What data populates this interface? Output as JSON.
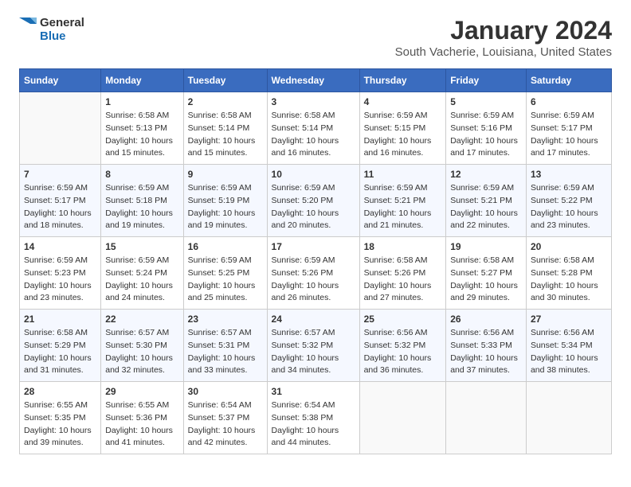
{
  "logo": {
    "line1": "General",
    "line2": "Blue"
  },
  "title": "January 2024",
  "subtitle": "South Vacherie, Louisiana, United States",
  "days_of_week": [
    "Sunday",
    "Monday",
    "Tuesday",
    "Wednesday",
    "Thursday",
    "Friday",
    "Saturday"
  ],
  "weeks": [
    [
      {
        "day": "",
        "sunrise": "",
        "sunset": "",
        "daylight": ""
      },
      {
        "day": "1",
        "sunrise": "Sunrise: 6:58 AM",
        "sunset": "Sunset: 5:13 PM",
        "daylight": "Daylight: 10 hours and 15 minutes."
      },
      {
        "day": "2",
        "sunrise": "Sunrise: 6:58 AM",
        "sunset": "Sunset: 5:14 PM",
        "daylight": "Daylight: 10 hours and 15 minutes."
      },
      {
        "day": "3",
        "sunrise": "Sunrise: 6:58 AM",
        "sunset": "Sunset: 5:14 PM",
        "daylight": "Daylight: 10 hours and 16 minutes."
      },
      {
        "day": "4",
        "sunrise": "Sunrise: 6:59 AM",
        "sunset": "Sunset: 5:15 PM",
        "daylight": "Daylight: 10 hours and 16 minutes."
      },
      {
        "day": "5",
        "sunrise": "Sunrise: 6:59 AM",
        "sunset": "Sunset: 5:16 PM",
        "daylight": "Daylight: 10 hours and 17 minutes."
      },
      {
        "day": "6",
        "sunrise": "Sunrise: 6:59 AM",
        "sunset": "Sunset: 5:17 PM",
        "daylight": "Daylight: 10 hours and 17 minutes."
      }
    ],
    [
      {
        "day": "7",
        "sunrise": "Sunrise: 6:59 AM",
        "sunset": "Sunset: 5:17 PM",
        "daylight": "Daylight: 10 hours and 18 minutes."
      },
      {
        "day": "8",
        "sunrise": "Sunrise: 6:59 AM",
        "sunset": "Sunset: 5:18 PM",
        "daylight": "Daylight: 10 hours and 19 minutes."
      },
      {
        "day": "9",
        "sunrise": "Sunrise: 6:59 AM",
        "sunset": "Sunset: 5:19 PM",
        "daylight": "Daylight: 10 hours and 19 minutes."
      },
      {
        "day": "10",
        "sunrise": "Sunrise: 6:59 AM",
        "sunset": "Sunset: 5:20 PM",
        "daylight": "Daylight: 10 hours and 20 minutes."
      },
      {
        "day": "11",
        "sunrise": "Sunrise: 6:59 AM",
        "sunset": "Sunset: 5:21 PM",
        "daylight": "Daylight: 10 hours and 21 minutes."
      },
      {
        "day": "12",
        "sunrise": "Sunrise: 6:59 AM",
        "sunset": "Sunset: 5:21 PM",
        "daylight": "Daylight: 10 hours and 22 minutes."
      },
      {
        "day": "13",
        "sunrise": "Sunrise: 6:59 AM",
        "sunset": "Sunset: 5:22 PM",
        "daylight": "Daylight: 10 hours and 23 minutes."
      }
    ],
    [
      {
        "day": "14",
        "sunrise": "Sunrise: 6:59 AM",
        "sunset": "Sunset: 5:23 PM",
        "daylight": "Daylight: 10 hours and 23 minutes."
      },
      {
        "day": "15",
        "sunrise": "Sunrise: 6:59 AM",
        "sunset": "Sunset: 5:24 PM",
        "daylight": "Daylight: 10 hours and 24 minutes."
      },
      {
        "day": "16",
        "sunrise": "Sunrise: 6:59 AM",
        "sunset": "Sunset: 5:25 PM",
        "daylight": "Daylight: 10 hours and 25 minutes."
      },
      {
        "day": "17",
        "sunrise": "Sunrise: 6:59 AM",
        "sunset": "Sunset: 5:26 PM",
        "daylight": "Daylight: 10 hours and 26 minutes."
      },
      {
        "day": "18",
        "sunrise": "Sunrise: 6:58 AM",
        "sunset": "Sunset: 5:26 PM",
        "daylight": "Daylight: 10 hours and 27 minutes."
      },
      {
        "day": "19",
        "sunrise": "Sunrise: 6:58 AM",
        "sunset": "Sunset: 5:27 PM",
        "daylight": "Daylight: 10 hours and 29 minutes."
      },
      {
        "day": "20",
        "sunrise": "Sunrise: 6:58 AM",
        "sunset": "Sunset: 5:28 PM",
        "daylight": "Daylight: 10 hours and 30 minutes."
      }
    ],
    [
      {
        "day": "21",
        "sunrise": "Sunrise: 6:58 AM",
        "sunset": "Sunset: 5:29 PM",
        "daylight": "Daylight: 10 hours and 31 minutes."
      },
      {
        "day": "22",
        "sunrise": "Sunrise: 6:57 AM",
        "sunset": "Sunset: 5:30 PM",
        "daylight": "Daylight: 10 hours and 32 minutes."
      },
      {
        "day": "23",
        "sunrise": "Sunrise: 6:57 AM",
        "sunset": "Sunset: 5:31 PM",
        "daylight": "Daylight: 10 hours and 33 minutes."
      },
      {
        "day": "24",
        "sunrise": "Sunrise: 6:57 AM",
        "sunset": "Sunset: 5:32 PM",
        "daylight": "Daylight: 10 hours and 34 minutes."
      },
      {
        "day": "25",
        "sunrise": "Sunrise: 6:56 AM",
        "sunset": "Sunset: 5:32 PM",
        "daylight": "Daylight: 10 hours and 36 minutes."
      },
      {
        "day": "26",
        "sunrise": "Sunrise: 6:56 AM",
        "sunset": "Sunset: 5:33 PM",
        "daylight": "Daylight: 10 hours and 37 minutes."
      },
      {
        "day": "27",
        "sunrise": "Sunrise: 6:56 AM",
        "sunset": "Sunset: 5:34 PM",
        "daylight": "Daylight: 10 hours and 38 minutes."
      }
    ],
    [
      {
        "day": "28",
        "sunrise": "Sunrise: 6:55 AM",
        "sunset": "Sunset: 5:35 PM",
        "daylight": "Daylight: 10 hours and 39 minutes."
      },
      {
        "day": "29",
        "sunrise": "Sunrise: 6:55 AM",
        "sunset": "Sunset: 5:36 PM",
        "daylight": "Daylight: 10 hours and 41 minutes."
      },
      {
        "day": "30",
        "sunrise": "Sunrise: 6:54 AM",
        "sunset": "Sunset: 5:37 PM",
        "daylight": "Daylight: 10 hours and 42 minutes."
      },
      {
        "day": "31",
        "sunrise": "Sunrise: 6:54 AM",
        "sunset": "Sunset: 5:38 PM",
        "daylight": "Daylight: 10 hours and 44 minutes."
      },
      {
        "day": "",
        "sunrise": "",
        "sunset": "",
        "daylight": ""
      },
      {
        "day": "",
        "sunrise": "",
        "sunset": "",
        "daylight": ""
      },
      {
        "day": "",
        "sunrise": "",
        "sunset": "",
        "daylight": ""
      }
    ]
  ]
}
